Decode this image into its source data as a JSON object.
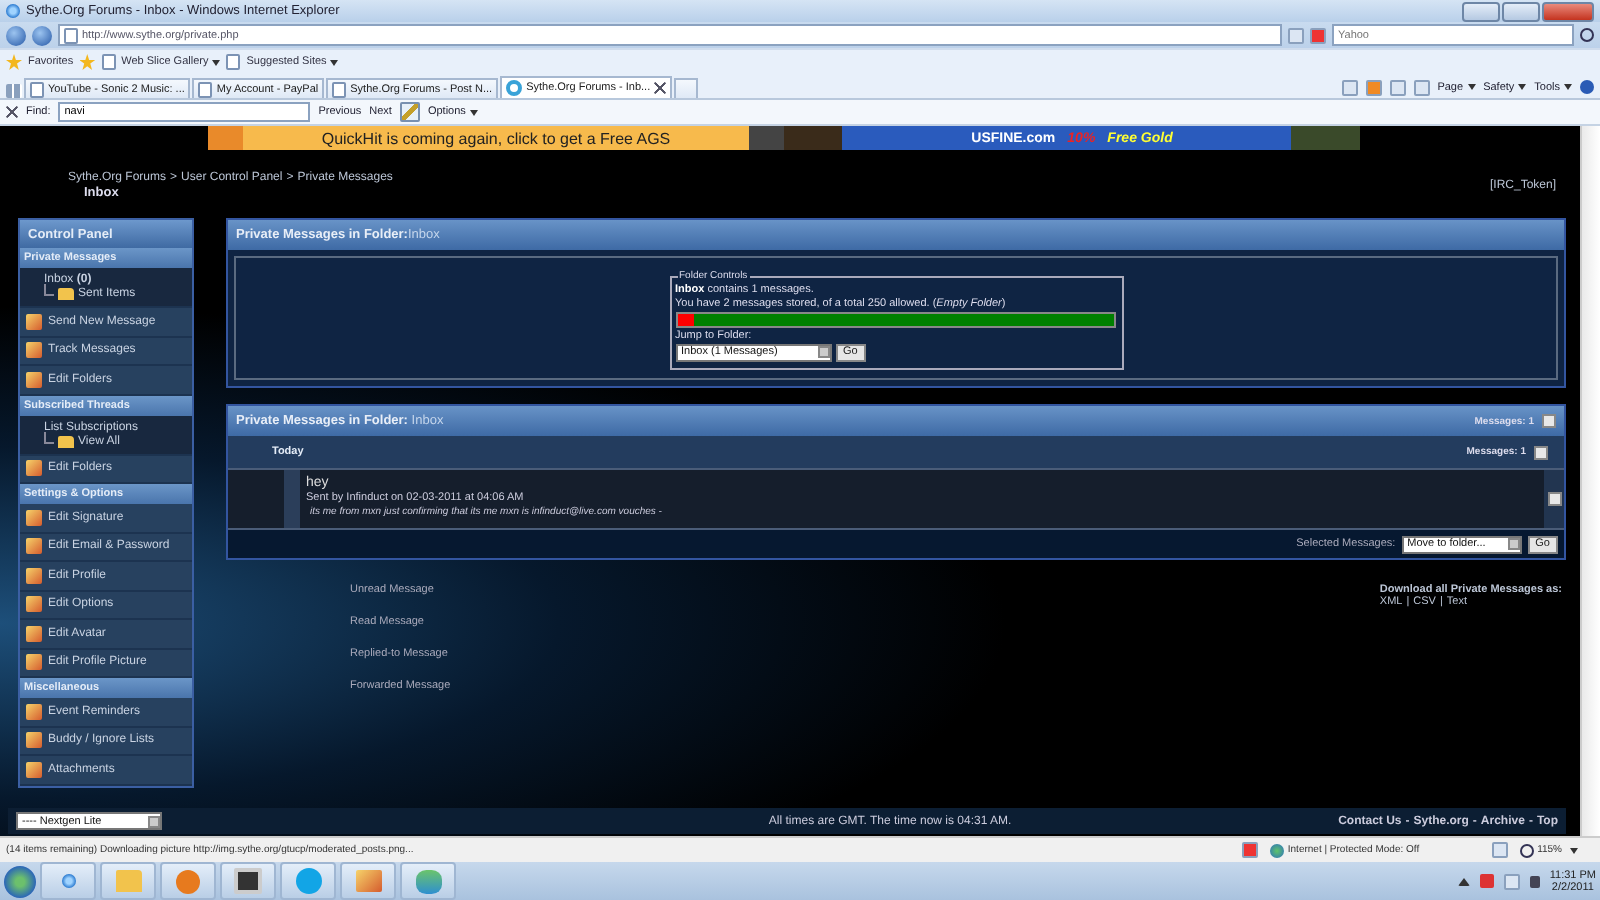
{
  "window": {
    "title": "Sythe.Org Forums - Inbox - Windows Internet Explorer"
  },
  "address_bar": {
    "url": "http://www.sythe.org/private.php",
    "search": {
      "placeholder": "Yahoo"
    }
  },
  "favorites_bar": {
    "label": "Favorites",
    "links": [
      "Web Slice Gallery",
      "Suggested Sites"
    ]
  },
  "tabs": [
    {
      "label": "YouTube - Sonic 2 Music: ...",
      "selected": false
    },
    {
      "label": "My Account - PayPal",
      "selected": false
    },
    {
      "label": "Sythe.Org Forums - Post N...",
      "selected": false
    },
    {
      "label": "Sythe.Org Forums - Inb...",
      "selected": true
    }
  ],
  "command_bar": [
    "Page",
    "Safety",
    "Tools"
  ],
  "find_bar": {
    "label": "Find:",
    "value": "navi",
    "buttons": [
      "Previous",
      "Next",
      "Options"
    ]
  },
  "banners": [
    {
      "text": "QuickHit is coming again, click to get a Free AGS"
    },
    {
      "text": "USFINE.com",
      "discount": "10%",
      "offer": "Free Gold"
    }
  ],
  "breadcrumb": {
    "items": [
      "Sythe.Org Forums",
      "User Control Panel",
      "Private Messages"
    ],
    "separator": ">",
    "page_title": "Inbox"
  },
  "irc_token": "[IRC_Token]",
  "sidebar": {
    "title": "Control Panel",
    "sections": [
      {
        "title": "Private Messages",
        "items": [
          {
            "kind": "tree",
            "label": "Inbox **(0)**",
            "children": [
              {
                "label": "Sent Items"
              }
            ]
          },
          {
            "kind": "link",
            "label": "Send New Message"
          },
          {
            "kind": "link",
            "label": "Track Messages"
          },
          {
            "kind": "link",
            "label": "Edit Folders"
          }
        ]
      },
      {
        "title": "Subscribed Threads",
        "items": [
          {
            "kind": "tree",
            "label": "List Subscriptions",
            "children": [
              {
                "label": "View All"
              }
            ]
          },
          {
            "kind": "link",
            "label": "Edit Folders"
          }
        ]
      },
      {
        "title": "Settings & Options",
        "items": [
          {
            "kind": "link",
            "label": "Edit Signature"
          },
          {
            "kind": "link",
            "label": "Edit Email & Password"
          },
          {
            "kind": "link",
            "label": "Edit Profile"
          },
          {
            "kind": "link",
            "label": "Edit Options"
          },
          {
            "kind": "link",
            "label": "Edit Avatar"
          },
          {
            "kind": "link",
            "label": "Edit Profile Picture"
          }
        ]
      },
      {
        "title": "Miscellaneous",
        "items": [
          {
            "kind": "link",
            "label": "Event Reminders"
          },
          {
            "kind": "link",
            "label": "Buddy / Ignore Lists"
          },
          {
            "kind": "link",
            "label": "Attachments"
          }
        ]
      }
    ]
  },
  "folder_panel": {
    "title": "Private Messages in Folder:",
    "folder": "Inbox",
    "controls": {
      "legend": "Folder Controls",
      "summary": "**Inbox** contains 1 messages.",
      "usage": "You have 2 messages stored, of a total 250 allowed. (*Empty Folder*)",
      "level": 0.04,
      "jump_label": "Jump to Folder:",
      "jump_value": "Inbox (1 Messages)",
      "button": "Go"
    }
  },
  "message_panel": {
    "title": "Private Messages in Folder:",
    "folder": "Inbox",
    "count": "Messages: 1",
    "checked": false,
    "groups": [
      {
        "label": "Today",
        "count": "Messages: 1",
        "checked": false,
        "messages": [
          {
            "subject": "hey",
            "sent": "Sent by Infinduct on 02-03-2011 at 04:06 AM",
            "preview": "its me from mxn just confirming that its me mxn is infinduct@live.com vouches -",
            "checked": false
          }
        ]
      }
    ],
    "selected_label": "Selected Messages:",
    "action": "Move to folder...",
    "button": "Go"
  },
  "legend": [
    "Unread Message",
    "Read Message",
    "Replied-to Message",
    "Forwarded Message"
  ],
  "download": {
    "label": "Download all Private Messages as:",
    "formats": [
      "XML",
      "CSV",
      "Text"
    ],
    "separator": "|"
  },
  "footer": {
    "style": "---- Nextgen Lite",
    "time": "All times are GMT. The time now is 04:31 AM.",
    "links": [
      "Contact Us",
      "Sythe.org",
      "Archive",
      "Top"
    ],
    "separator": "-"
  },
  "status_bar": {
    "text": "(14 items remaining) Downloading picture http://img.sythe.org/gtucp/moderated_posts.png...",
    "zone": "Internet | Protected Mode: Off",
    "zoom": "115%"
  },
  "taskbar": {
    "time": "11:31 PM",
    "date": "2/2/2011"
  }
}
